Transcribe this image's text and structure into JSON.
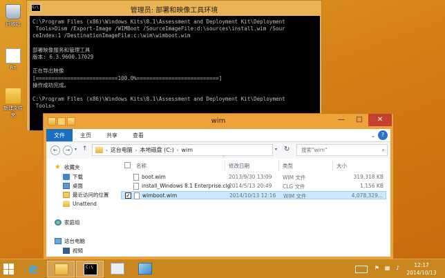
{
  "desktop": {
    "icons": [
      {
        "label": "回收站",
        "icon": "recycle-bin-icon"
      },
      {
        "label": "Rh",
        "icon": "file-icon"
      },
      {
        "label": "新建文件夹",
        "icon": "folder-icon"
      }
    ]
  },
  "console": {
    "title": "管理员: 部署和映像工具环境",
    "icon_text": "C:\\",
    "lines": [
      "C:\\Program Files (x86)\\Windows Kits\\8.1\\Assessment and Deployment Kit\\Deployment",
      " Tools>Dism /Export-Image /WIMBoot /SourceImageFile:d:\\sources\\install.wim /Sour",
      "ceIndex:1 /DestinationImageFile:c:\\wim\\wimboot.wim",
      "",
      "部署映像服务和管理工具",
      "版本: 6.3.9600.17029",
      "",
      "正在导出映像",
      "[==========================100.0%==========================]",
      "操作成功完成。",
      "",
      "C:\\Program Files (x86)\\Windows Kits\\8.1\\Assessment and Deployment Kit\\Deployment",
      " Tools>"
    ]
  },
  "explorer": {
    "title": "wim",
    "window_controls": {
      "minimize": "—",
      "maximize": "□",
      "close": "✕"
    },
    "ribbon": {
      "tabs": [
        "文件",
        "主页",
        "共享",
        "查看"
      ],
      "expand": "⌄",
      "help": "?"
    },
    "address": {
      "back": "←",
      "forward": "→",
      "recent": "▾",
      "up": "↑",
      "crumbs": [
        "这台电脑",
        "本地磁盘 (C:)",
        "wim"
      ],
      "separator": "›",
      "dropdown": "▾",
      "refresh": "↻",
      "search_placeholder": "搜索\"wim\"",
      "search_icon": "⌕"
    },
    "nav": {
      "favorites": "收藏夹",
      "favorite_items": [
        "下载",
        "桌面",
        "最近访问的位置",
        "Unattend"
      ],
      "homegroup": "家庭组",
      "thispc": "这台电脑",
      "thispc_items": [
        "视频"
      ]
    },
    "columns": {
      "name": "名称",
      "modified": "修改日期",
      "type": "类型",
      "size": "大小"
    },
    "files": [
      {
        "name": "boot.wim",
        "modified": "2013/9/30 13:09",
        "type": "WIM 文件",
        "size": "319,318 KB",
        "selected": false
      },
      {
        "name": "install_Windows 8.1 Enterprise.clg",
        "modified": "2014/5/13 20:49",
        "type": "CLG 文件",
        "size": "1,156 KB",
        "selected": false
      },
      {
        "name": "wimboot.wim",
        "modified": "2014/10/13 12:16",
        "type": "WIM 文件",
        "size": "4,078,329...",
        "selected": true
      }
    ]
  },
  "taskbar": {
    "items": [
      "internet-explorer",
      "file-explorer",
      "command-prompt",
      "setup",
      "media"
    ],
    "cmd_icon_text": "C:\\",
    "clock": {
      "time": "12:17",
      "date": "2014/10/13"
    }
  },
  "colors": {
    "accent": "#1a6fc1",
    "selection": "#cce8ff",
    "desktop": "#d88a1c"
  }
}
